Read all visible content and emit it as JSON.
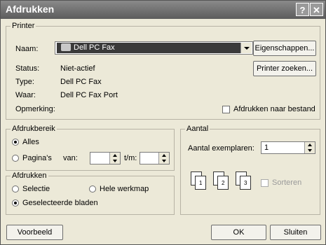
{
  "window": {
    "title": "Afdrukken"
  },
  "printer": {
    "legend": "Printer",
    "name_label": "Naam:",
    "name_value": "Dell PC Fax",
    "status_label": "Status:",
    "status_value": "Niet-actief",
    "type_label": "Type:",
    "type_value": "Dell PC Fax",
    "where_label": "Waar:",
    "where_value": "Dell PC Fax Port",
    "comment_label": "Opmerking:",
    "properties_button": "Eigenschappen...",
    "find_printer_button": "Printer zoeken...",
    "print_to_file": "Afdrukken naar bestand"
  },
  "range": {
    "legend": "Afdrukbereik",
    "all": "Alles",
    "pages": "Pagina's",
    "from": "van:",
    "to": "t/m:"
  },
  "print_what": {
    "legend": "Afdrukken",
    "selection": "Selectie",
    "whole_workbook": "Hele werkmap",
    "selected_sheets": "Geselecteerde bladen"
  },
  "copies": {
    "legend": "Aantal",
    "copies_label": "Aantal exemplaren:",
    "copies_value": "1",
    "collate": "Sorteren",
    "page1": "1",
    "page2": "2",
    "page3": "3"
  },
  "buttons": {
    "preview": "Voorbeeld",
    "ok": "OK",
    "close": "Sluiten"
  }
}
